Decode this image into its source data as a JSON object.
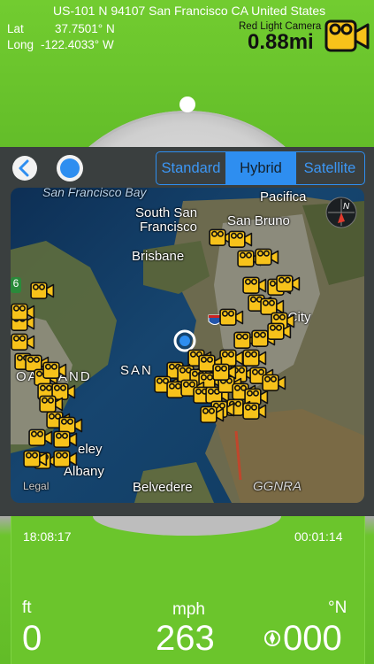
{
  "header": {
    "address": "US-101 N 94107 San Francisco  CA United States",
    "lat_label": "Lat",
    "lat_value": "37.7501° N",
    "long_label": "Long",
    "long_value": "-122.4033° W",
    "alert_title": "Red Light Camera",
    "alert_distance": "0.88mi"
  },
  "map_controls": {
    "back_icon": "chevron-left-icon",
    "location_icon": "location-dot-icon",
    "tabs": [
      {
        "label": "Standard",
        "active": false
      },
      {
        "label": "Hybrid",
        "active": true
      },
      {
        "label": "Satellite",
        "active": false
      }
    ]
  },
  "map": {
    "labels": {
      "bay": "San Francisco Bay",
      "pacifica": "Pacifica",
      "south_sf": "South San",
      "south_sf2": "Francisco",
      "san_bruno": "San Bruno",
      "brisbane": "Brisbane",
      "daly": "y City",
      "oakland": "OAKLAND",
      "san": "SAN",
      "berkeley": "eley",
      "albany": "Albany",
      "belvedere": "Belvedere",
      "ggnra": "GGNRA",
      "legal": "Legal",
      "sign": "6"
    },
    "compass_label": "N"
  },
  "footer": {
    "time_left": "18:08:17",
    "time_right": "00:01:14",
    "unit_left": "ft",
    "unit_center": "mph",
    "unit_right": "°N",
    "altitude": "0",
    "speed": "263",
    "heading": "000"
  },
  "colors": {
    "green": "#6cc52c",
    "accent_blue": "#2e8ef0",
    "camera_yellow": "#f7c21a"
  }
}
